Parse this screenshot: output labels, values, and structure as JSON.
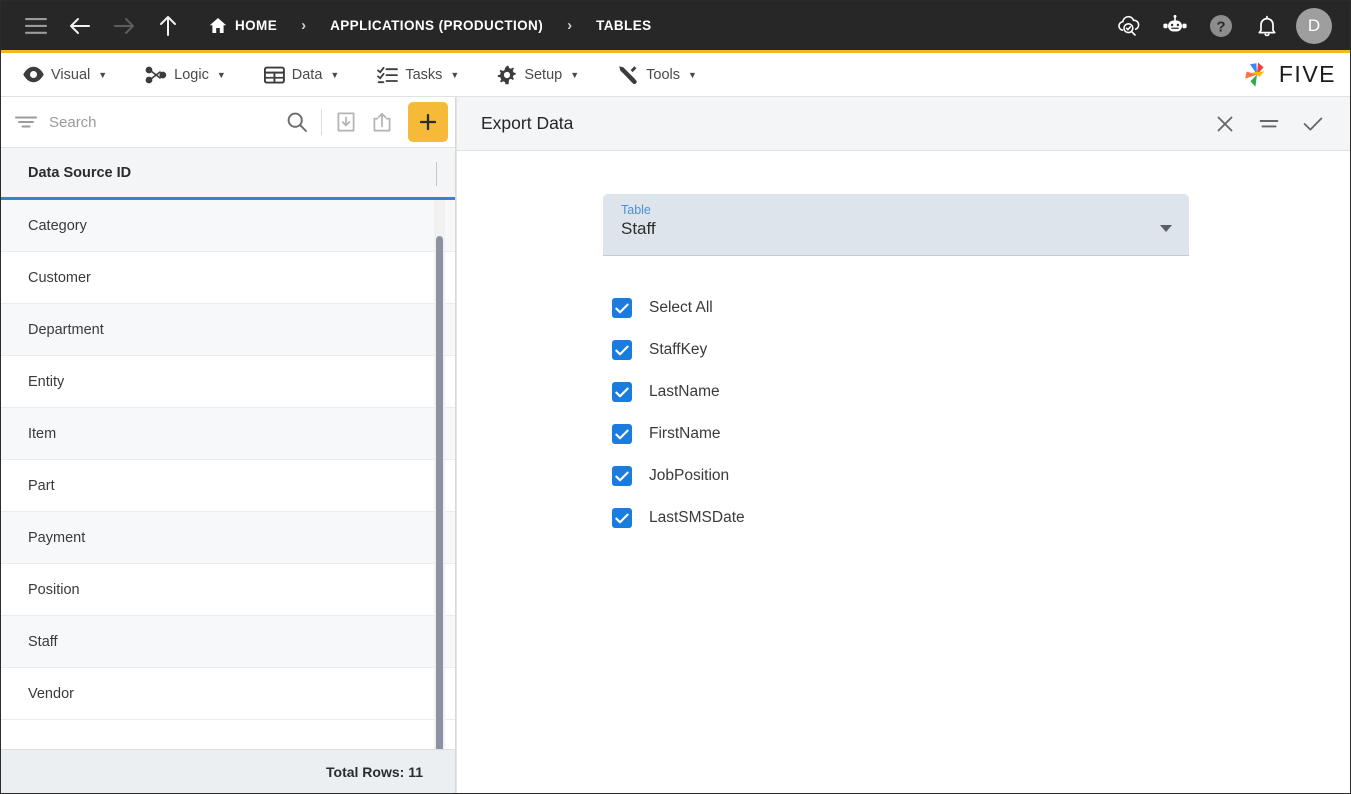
{
  "topbar": {
    "menu_icon": "hamburger-icon",
    "back_icon": "arrow-left-icon",
    "forward_icon": "arrow-right-icon",
    "up_icon": "arrow-up-icon",
    "breadcrumbs": [
      {
        "label": "HOME",
        "icon": "home-icon"
      },
      {
        "label": "APPLICATIONS (PRODUCTION)",
        "icon": ""
      },
      {
        "label": "TABLES",
        "icon": ""
      }
    ],
    "separator": "›",
    "right_icons": [
      {
        "name": "cloud-check-icon"
      },
      {
        "name": "robot-assistant-icon"
      },
      {
        "name": "help-icon"
      },
      {
        "name": "notification-bell-icon"
      }
    ],
    "avatar_initial": "D",
    "accent_color": "#f2b824",
    "background_color": "#272727"
  },
  "menubar": {
    "items": [
      {
        "label": "Visual",
        "icon": "eye-icon",
        "caret": "▼"
      },
      {
        "label": "Logic",
        "icon": "logic-nodes-icon",
        "caret": "▼"
      },
      {
        "label": "Data",
        "icon": "table-grid-icon",
        "caret": "▼"
      },
      {
        "label": "Tasks",
        "icon": "checklist-icon",
        "caret": "▼"
      },
      {
        "label": "Setup",
        "icon": "gear-icon",
        "caret": "▼"
      },
      {
        "label": "Tools",
        "icon": "tools-icon",
        "caret": "▼"
      }
    ],
    "brand": {
      "word": "FIVE",
      "logo_icon": "five-pinwheel-logo",
      "logo_colors": [
        "#4285f4",
        "#ea4335",
        "#fbbc05",
        "#34a853",
        "#ff7043"
      ]
    }
  },
  "sidebar": {
    "search": {
      "placeholder": "Search",
      "value": "",
      "filter_icon": "filter-icon",
      "search_icon": "search-icon",
      "import_icon": "import-icon",
      "export_icon": "export-icon",
      "add_label": "+",
      "add_color": "#f5bb38"
    },
    "grid": {
      "column_header": "Data Source ID",
      "header_underline_color": "#3b7dd8",
      "rows": [
        {
          "name": "Category"
        },
        {
          "name": "Customer"
        },
        {
          "name": "Department"
        },
        {
          "name": "Entity"
        },
        {
          "name": "Item"
        },
        {
          "name": "Part"
        },
        {
          "name": "Payment"
        },
        {
          "name": "Position"
        },
        {
          "name": "Staff"
        },
        {
          "name": "Vendor"
        }
      ],
      "footer_text": "Total Rows: 11"
    }
  },
  "panel": {
    "title": "Export Data",
    "actions": [
      {
        "name": "close-icon",
        "label": ""
      },
      {
        "name": "menu-lines-icon",
        "label": ""
      },
      {
        "name": "confirm-check-icon",
        "label": ""
      }
    ],
    "table_select": {
      "label": "Table",
      "value": "Staff",
      "caret_icon": "chevron-down-icon",
      "background_color": "#dde4ec",
      "label_color": "#4d90d5"
    },
    "checkbox_color": "#1b7ce0",
    "checkboxes": [
      {
        "label": "Select All",
        "checked": true
      },
      {
        "label": "StaffKey",
        "checked": true
      },
      {
        "label": "LastName",
        "checked": true
      },
      {
        "label": "FirstName",
        "checked": true
      },
      {
        "label": "JobPosition",
        "checked": true
      },
      {
        "label": "LastSMSDate",
        "checked": true
      }
    ],
    "annotation": {
      "type": "arrow",
      "color": "#e8231a",
      "points_to": "table-dropdown-caret"
    }
  }
}
